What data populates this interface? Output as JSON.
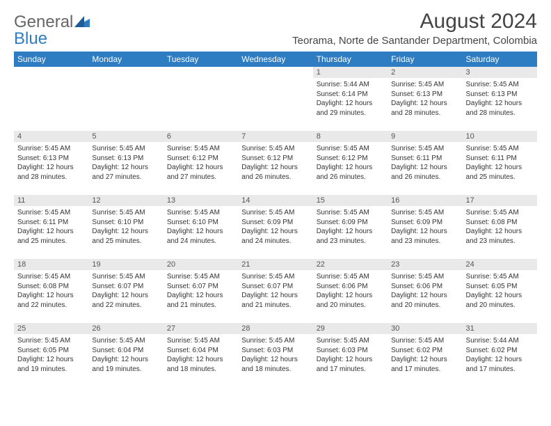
{
  "logo": {
    "general": "General",
    "blue": "Blue"
  },
  "title": "August 2024",
  "subtitle": "Teorama, Norte de Santander Department, Colombia",
  "weekdays": [
    "Sunday",
    "Monday",
    "Tuesday",
    "Wednesday",
    "Thursday",
    "Friday",
    "Saturday"
  ],
  "weeks": [
    [
      null,
      null,
      null,
      null,
      {
        "n": "1",
        "sunrise": "5:44 AM",
        "sunset": "6:14 PM",
        "daylight": "12 hours and 29 minutes."
      },
      {
        "n": "2",
        "sunrise": "5:45 AM",
        "sunset": "6:13 PM",
        "daylight": "12 hours and 28 minutes."
      },
      {
        "n": "3",
        "sunrise": "5:45 AM",
        "sunset": "6:13 PM",
        "daylight": "12 hours and 28 minutes."
      }
    ],
    [
      {
        "n": "4",
        "sunrise": "5:45 AM",
        "sunset": "6:13 PM",
        "daylight": "12 hours and 28 minutes."
      },
      {
        "n": "5",
        "sunrise": "5:45 AM",
        "sunset": "6:13 PM",
        "daylight": "12 hours and 27 minutes."
      },
      {
        "n": "6",
        "sunrise": "5:45 AM",
        "sunset": "6:12 PM",
        "daylight": "12 hours and 27 minutes."
      },
      {
        "n": "7",
        "sunrise": "5:45 AM",
        "sunset": "6:12 PM",
        "daylight": "12 hours and 26 minutes."
      },
      {
        "n": "8",
        "sunrise": "5:45 AM",
        "sunset": "6:12 PM",
        "daylight": "12 hours and 26 minutes."
      },
      {
        "n": "9",
        "sunrise": "5:45 AM",
        "sunset": "6:11 PM",
        "daylight": "12 hours and 26 minutes."
      },
      {
        "n": "10",
        "sunrise": "5:45 AM",
        "sunset": "6:11 PM",
        "daylight": "12 hours and 25 minutes."
      }
    ],
    [
      {
        "n": "11",
        "sunrise": "5:45 AM",
        "sunset": "6:11 PM",
        "daylight": "12 hours and 25 minutes."
      },
      {
        "n": "12",
        "sunrise": "5:45 AM",
        "sunset": "6:10 PM",
        "daylight": "12 hours and 25 minutes."
      },
      {
        "n": "13",
        "sunrise": "5:45 AM",
        "sunset": "6:10 PM",
        "daylight": "12 hours and 24 minutes."
      },
      {
        "n": "14",
        "sunrise": "5:45 AM",
        "sunset": "6:09 PM",
        "daylight": "12 hours and 24 minutes."
      },
      {
        "n": "15",
        "sunrise": "5:45 AM",
        "sunset": "6:09 PM",
        "daylight": "12 hours and 23 minutes."
      },
      {
        "n": "16",
        "sunrise": "5:45 AM",
        "sunset": "6:09 PM",
        "daylight": "12 hours and 23 minutes."
      },
      {
        "n": "17",
        "sunrise": "5:45 AM",
        "sunset": "6:08 PM",
        "daylight": "12 hours and 23 minutes."
      }
    ],
    [
      {
        "n": "18",
        "sunrise": "5:45 AM",
        "sunset": "6:08 PM",
        "daylight": "12 hours and 22 minutes."
      },
      {
        "n": "19",
        "sunrise": "5:45 AM",
        "sunset": "6:07 PM",
        "daylight": "12 hours and 22 minutes."
      },
      {
        "n": "20",
        "sunrise": "5:45 AM",
        "sunset": "6:07 PM",
        "daylight": "12 hours and 21 minutes."
      },
      {
        "n": "21",
        "sunrise": "5:45 AM",
        "sunset": "6:07 PM",
        "daylight": "12 hours and 21 minutes."
      },
      {
        "n": "22",
        "sunrise": "5:45 AM",
        "sunset": "6:06 PM",
        "daylight": "12 hours and 20 minutes."
      },
      {
        "n": "23",
        "sunrise": "5:45 AM",
        "sunset": "6:06 PM",
        "daylight": "12 hours and 20 minutes."
      },
      {
        "n": "24",
        "sunrise": "5:45 AM",
        "sunset": "6:05 PM",
        "daylight": "12 hours and 20 minutes."
      }
    ],
    [
      {
        "n": "25",
        "sunrise": "5:45 AM",
        "sunset": "6:05 PM",
        "daylight": "12 hours and 19 minutes."
      },
      {
        "n": "26",
        "sunrise": "5:45 AM",
        "sunset": "6:04 PM",
        "daylight": "12 hours and 19 minutes."
      },
      {
        "n": "27",
        "sunrise": "5:45 AM",
        "sunset": "6:04 PM",
        "daylight": "12 hours and 18 minutes."
      },
      {
        "n": "28",
        "sunrise": "5:45 AM",
        "sunset": "6:03 PM",
        "daylight": "12 hours and 18 minutes."
      },
      {
        "n": "29",
        "sunrise": "5:45 AM",
        "sunset": "6:03 PM",
        "daylight": "12 hours and 17 minutes."
      },
      {
        "n": "30",
        "sunrise": "5:45 AM",
        "sunset": "6:02 PM",
        "daylight": "12 hours and 17 minutes."
      },
      {
        "n": "31",
        "sunrise": "5:44 AM",
        "sunset": "6:02 PM",
        "daylight": "12 hours and 17 minutes."
      }
    ]
  ],
  "labels": {
    "sunrise": "Sunrise: ",
    "sunset": "Sunset: ",
    "daylight": "Daylight: "
  }
}
